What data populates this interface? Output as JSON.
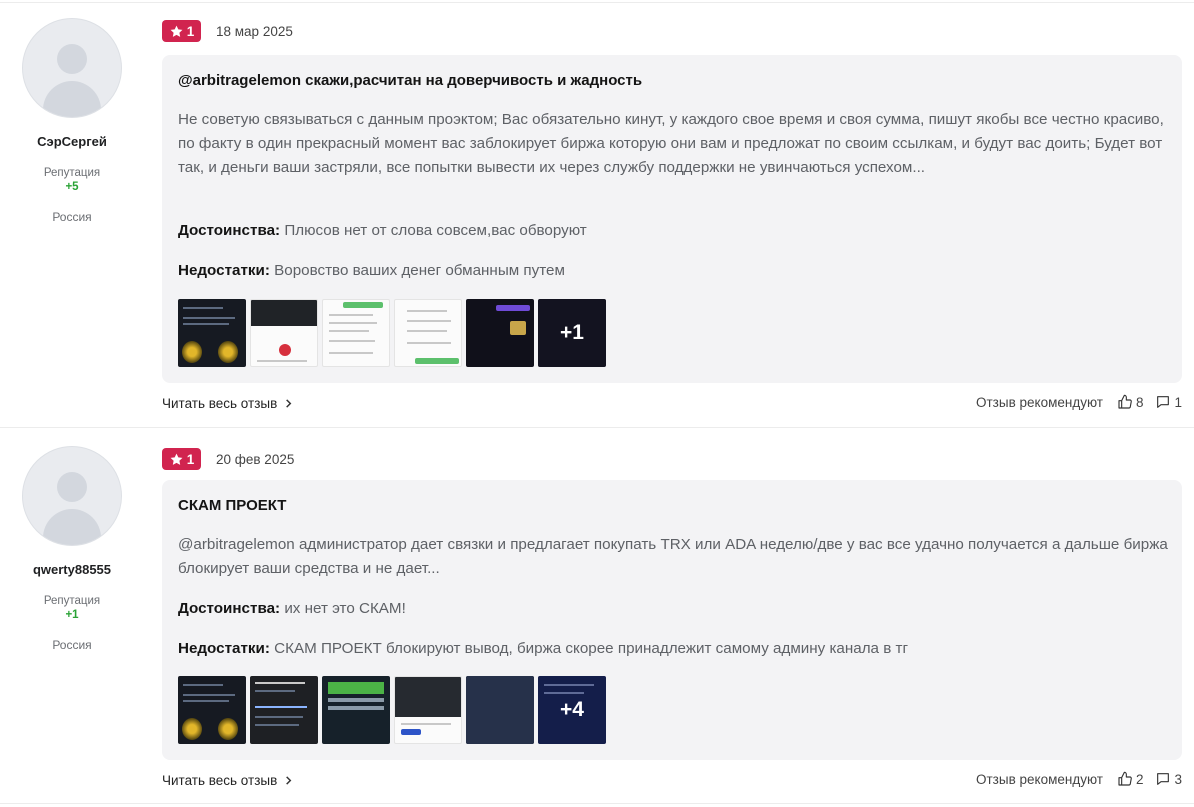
{
  "reviews": [
    {
      "author": {
        "name": "СэрСергей",
        "reputation_label": "Репутация",
        "reputation_value": "+5",
        "country": "Россия"
      },
      "rating": "1",
      "date": "18 мар 2025",
      "title": "@arbitragelemon скажи,расчитан на доверчивость и жадность",
      "text": "Не советую связываться с данным проэктом; Вас обязательно кинут, у каждого свое время и своя сумма, пишут якобы все честно красиво, по факту в один прекрасный момент вас заблокирует биржа которую они вам и предложат по своим ссылкам, и будут вас доить; Будет вот так, и деньги ваши застряли, все попытки вывести их через службу поддержки не увинчаються успехом...",
      "pros_label": "Достоинства:",
      "pros": "Плюсов нет от слова совсем,вас обворуют",
      "cons_label": "Недостатки:",
      "cons": "Воровство ваших денег обманным путем",
      "more_photos": "+1",
      "read_more": "Читать весь отзыв",
      "recommend_label": "Отзыв рекомендуют",
      "likes": "8",
      "comments": "1"
    },
    {
      "author": {
        "name": "qwerty88555",
        "reputation_label": "Репутация",
        "reputation_value": "+1",
        "country": "Россия"
      },
      "rating": "1",
      "date": "20 фев 2025",
      "title": "СКАМ ПРОЕКТ",
      "text": "@arbitragelemon администратор дает связки и предлагает покупать TRX или ADA неделю/две у вас все удачно получается а дальше биржа блокирует ваши средства и не дает...",
      "pros_label": "Достоинства:",
      "pros": "их нет это СКАМ!",
      "cons_label": "Недостатки:",
      "cons": "СКАМ ПРОЕКТ блокируют вывод, биржа скорее принадлежит самому админу канала в тг",
      "more_photos": "+4",
      "read_more": "Читать весь отзыв",
      "recommend_label": "Отзыв рекомендуют",
      "likes": "2",
      "comments": "3"
    }
  ],
  "colors": {
    "badge": "#d1244f",
    "reputation": "#2aa336",
    "card_bg": "#f3f3f5"
  },
  "icons": [
    "star-icon",
    "chevron-right-icon",
    "thumbs-up-icon",
    "comment-icon"
  ]
}
